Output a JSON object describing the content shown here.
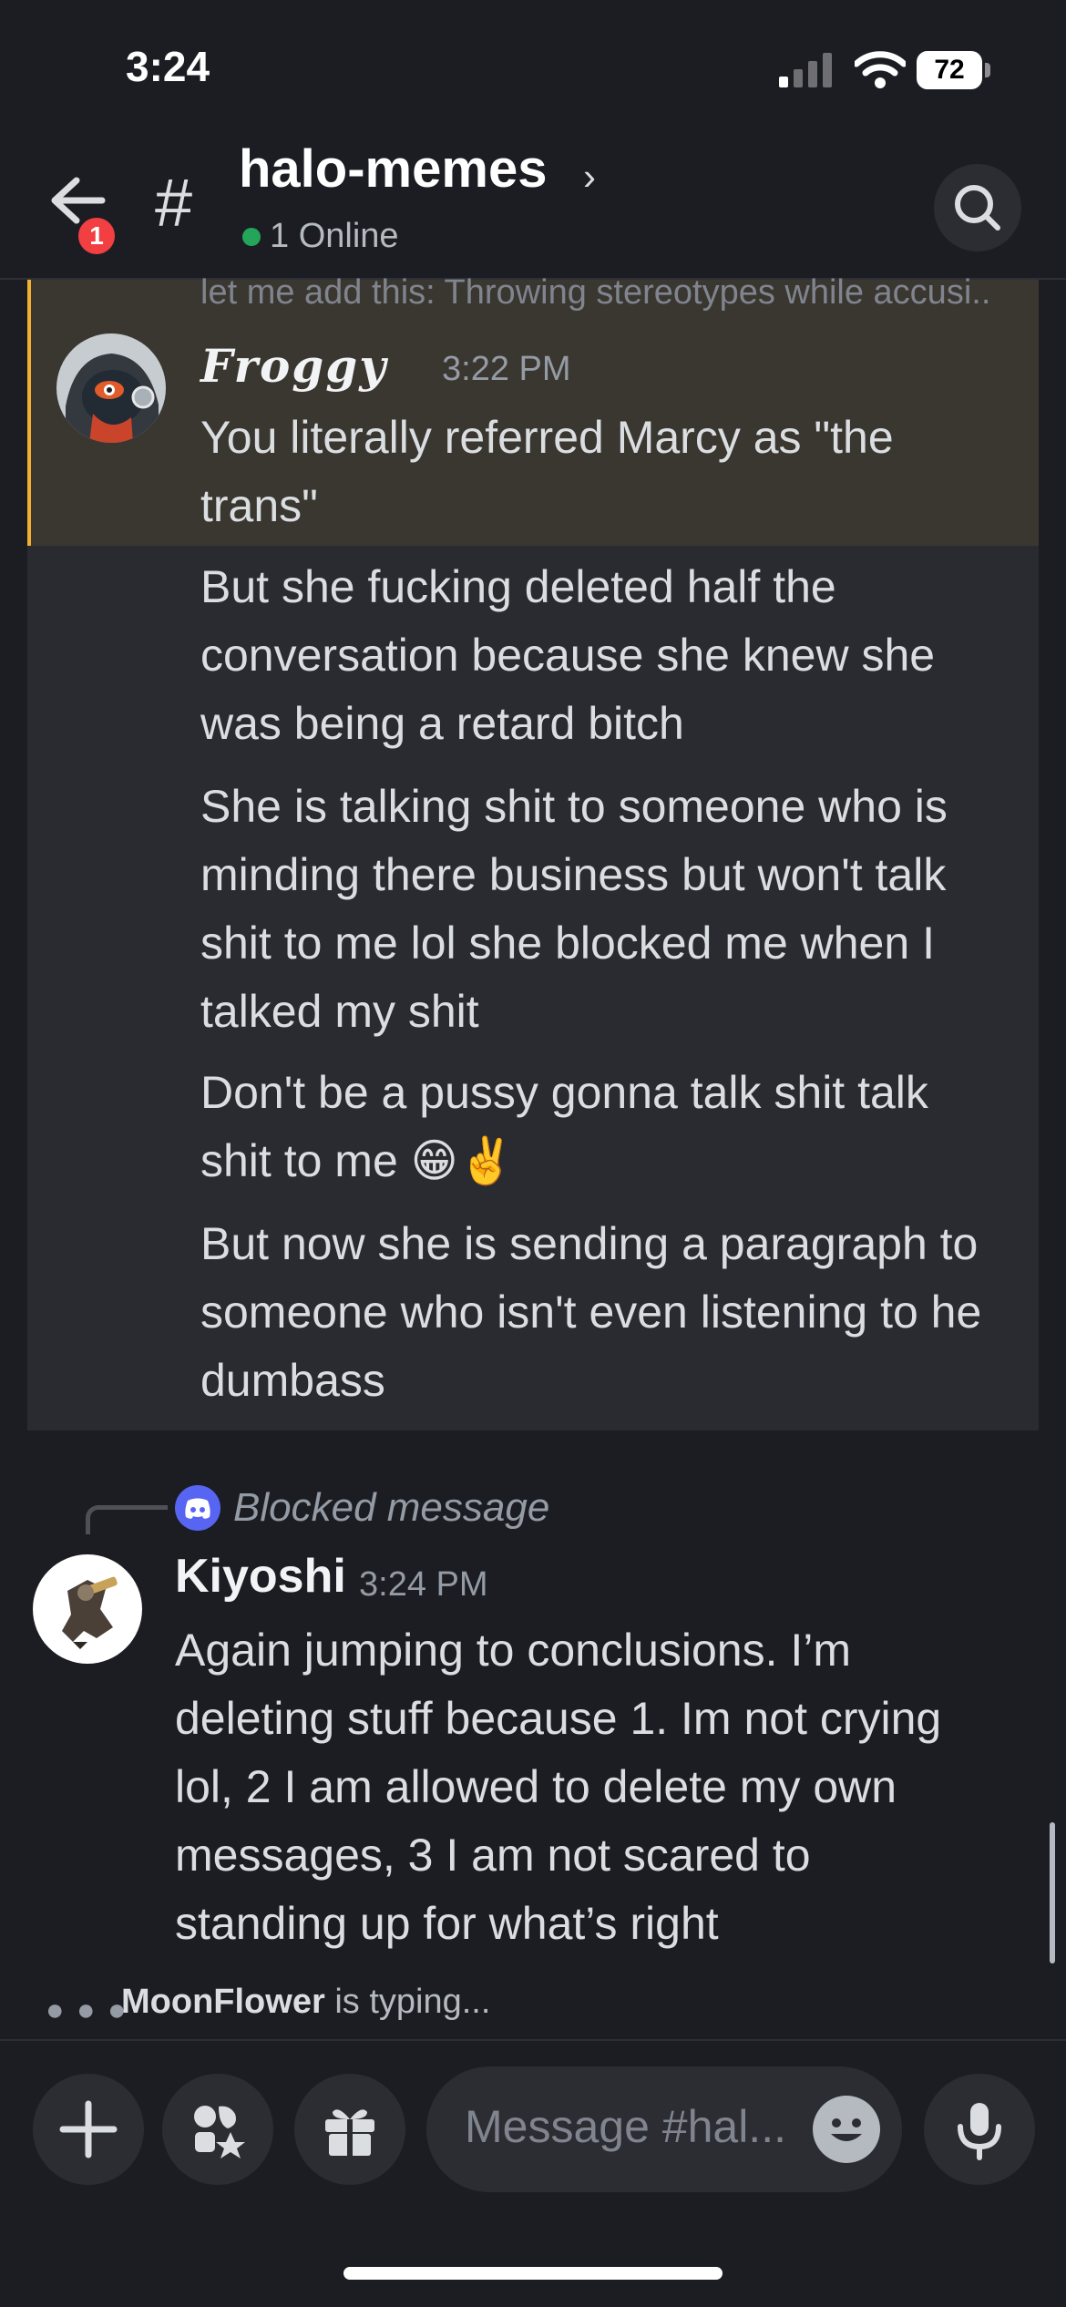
{
  "status_bar": {
    "time": "3:24",
    "battery": "72"
  },
  "header": {
    "back_badge": "1",
    "channel_name": "halo-memes",
    "chevron": "›",
    "online_status": "1 Online"
  },
  "highlighted_message": {
    "reply_preview": "let me add this: Throwing stereotypes while accusi..",
    "author": "Froggy",
    "timestamp": "3:22 PM",
    "lines": [
      "You literally referred Marcy as \"the",
      "trans\""
    ]
  },
  "followup_messages": [
    {
      "lines": [
        "But she fucking deleted half the",
        "conversation because she knew she",
        "was being a retard bitch"
      ]
    },
    {
      "lines": [
        "She is talking shit to someone who is",
        "minding there business but won't talk",
        "shit to me lol she blocked me when I",
        "talked my shit"
      ]
    },
    {
      "lines": [
        "Don't be a pussy gonna talk shit talk",
        "shit to me 😁✌️"
      ]
    },
    {
      "lines": [
        "But now she is sending a paragraph to",
        "someone who isn't even listening to he",
        "dumbass"
      ]
    }
  ],
  "reply_message": {
    "blocked_label": "Blocked message",
    "author": "Kiyoshi",
    "timestamp": "3:24 PM",
    "lines": [
      "Again jumping to conclusions. I’m",
      "deleting stuff because 1. Im not crying",
      "lol, 2 I am allowed to delete my own",
      "messages, 3 I am not scared to",
      "standing up for what’s right"
    ]
  },
  "typing_indicator": {
    "user": "MoonFlower",
    "text": " is typing..."
  },
  "composer": {
    "placeholder": "Message #hal..."
  },
  "icons": {
    "back": "arrow-left-icon",
    "channel": "hash-icon",
    "search": "search-icon",
    "add": "plus-icon",
    "apps": "apps-icon",
    "gift": "gift-icon",
    "emoji": "emoji-icon",
    "mic": "microphone-icon",
    "discord": "discord-logo-icon"
  },
  "colors": {
    "background": "#1c1d23",
    "highlight": "#3a3731",
    "highlight_bar": "#f0b132",
    "online": "#23a55a",
    "badge": "#f23f42",
    "discord": "#5865f2"
  }
}
